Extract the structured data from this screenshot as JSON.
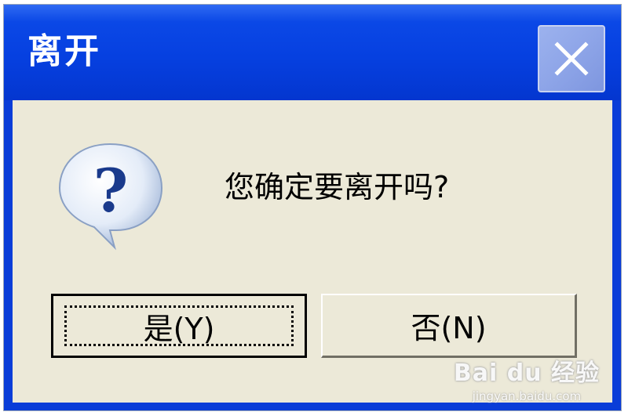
{
  "dialog": {
    "title": "离开",
    "message": "您确定要离开吗?",
    "buttons": {
      "yes_label": "是(Y)",
      "no_label": "否(N)"
    },
    "close_icon": "close-icon",
    "message_icon": "question-icon"
  },
  "watermark": {
    "logo_text": "Bai du 经验",
    "url": "jingyan.baidu.com"
  },
  "colors": {
    "titlebar": "#0640e0",
    "client_bg": "#ece9d8",
    "close_button": "#8ea5e8"
  }
}
